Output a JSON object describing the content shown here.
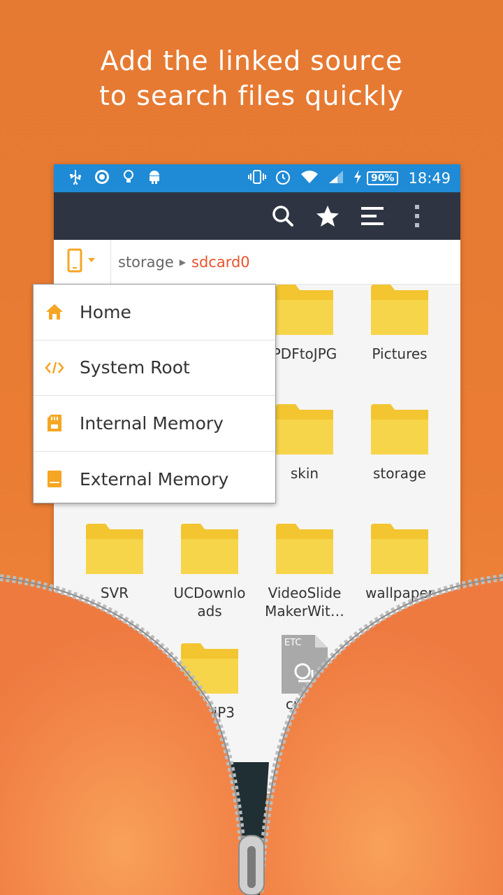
{
  "headline": {
    "line1": "Add the linked source",
    "line2": "to search files quickly"
  },
  "status_bar": {
    "battery": "90%",
    "time": "18:49"
  },
  "toolbar": {
    "icons": [
      "search-icon",
      "star-icon",
      "list-icon",
      "overflow-menu-icon"
    ]
  },
  "path": {
    "crumbs": [
      "storage",
      "sdcard0"
    ]
  },
  "menu": {
    "items": [
      {
        "label": "Home",
        "icon": "home-icon"
      },
      {
        "label": "System Root",
        "icon": "code-icon"
      },
      {
        "label": "Internal Memory",
        "icon": "sd-card-icon"
      },
      {
        "label": "External Memory",
        "icon": "storage-icon"
      }
    ]
  },
  "files": {
    "items": [
      {
        "name": "PDFtoJPG",
        "type": "folder"
      },
      {
        "name": "Pictures",
        "type": "folder"
      },
      {
        "name": "skin",
        "type": "folder"
      },
      {
        "name": "storage",
        "type": "folder"
      },
      {
        "name": "SVR",
        "type": "folder"
      },
      {
        "name": "UCDownloads",
        "type": "folder"
      },
      {
        "name": "VideoSlideMakerWit…",
        "type": "folder"
      },
      {
        "name": "wallpaper",
        "type": "folder"
      },
      {
        "name": "MP3",
        "type": "folder"
      },
      {
        "name": "custo",
        "type": "file",
        "badge": "ETC"
      }
    ]
  },
  "colors": {
    "background": "#e8742f",
    "status_bar": "#1f8ad6",
    "toolbar": "#2e3441",
    "folder": "#f7d54a",
    "folder_tab": "#f2c531",
    "accent": "#e8542a",
    "menu_icon": "#f5a623"
  }
}
